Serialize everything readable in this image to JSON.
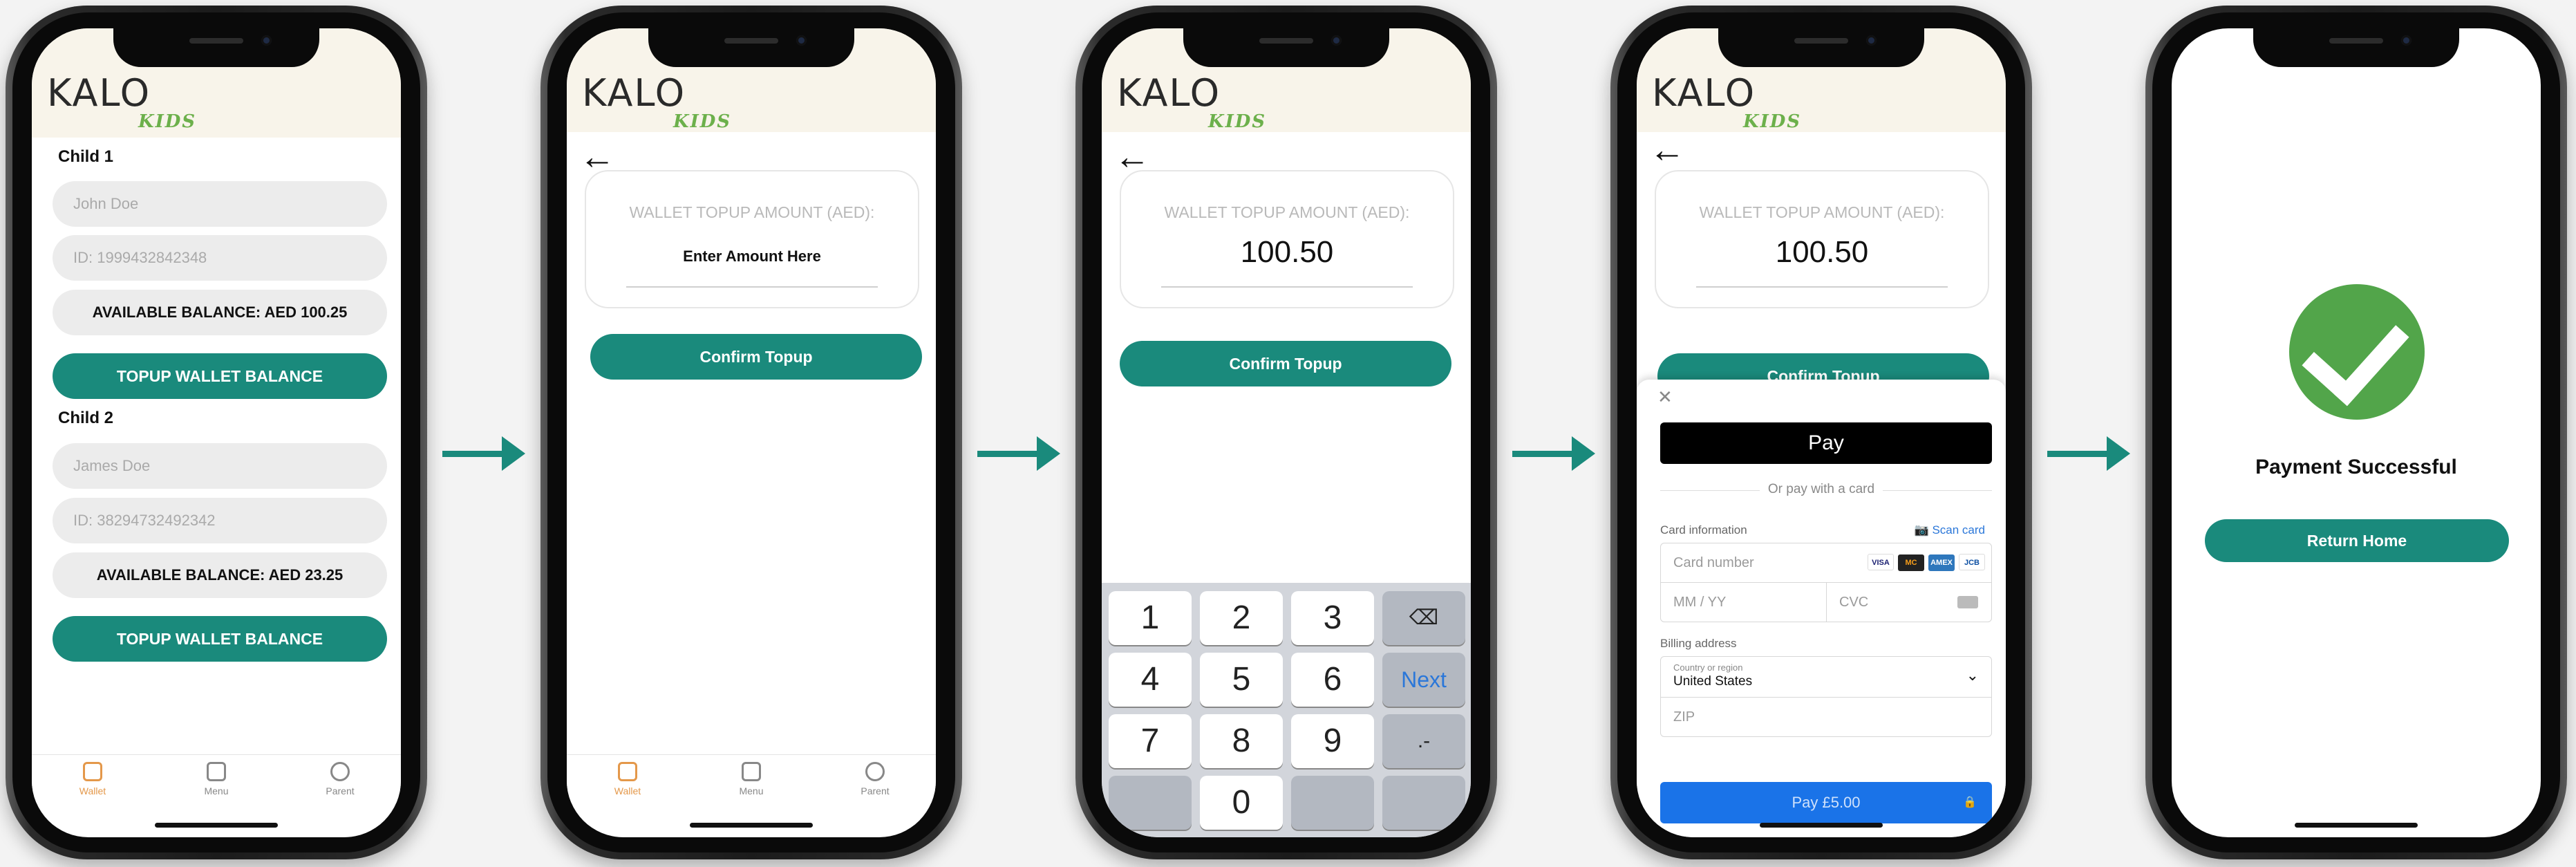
{
  "logo": {
    "word": "KALO",
    "sub": "KIDS"
  },
  "screen1": {
    "child1": {
      "title": "Child 1",
      "name_placeholder": "John Doe",
      "id_placeholder": "ID: 1999432842348",
      "balance": "AVAILABLE BALANCE: AED 100.25",
      "button": "TOPUP WALLET BALANCE"
    },
    "child2": {
      "title": "Child 2",
      "name_placeholder": "James Doe",
      "id_placeholder": "ID: 38294732492342",
      "balance": "AVAILABLE BALANCE: AED 23.25",
      "button": "TOPUP WALLET BALANCE"
    }
  },
  "tabs": [
    {
      "label": "Wallet",
      "icon": "wallet-icon"
    },
    {
      "label": "Menu",
      "icon": "menu-icon"
    },
    {
      "label": "Parent",
      "icon": "user-icon"
    }
  ],
  "topup": {
    "title": "WALLET TOPUP AMOUNT (AED):",
    "placeholder": "Enter Amount Here",
    "amount": "100.50",
    "confirm": "Confirm Topup"
  },
  "keyboard": {
    "keys": [
      "1",
      "2",
      "3",
      "⌫",
      "4",
      "5",
      "6",
      "Next",
      "7",
      "8",
      "9",
      ".-",
      "0"
    ]
  },
  "payment_sheet": {
    "close": "✕",
    "apple_pay": " Pay",
    "or_text": "Or pay with a card",
    "card_info": "Card information",
    "scan": "Scan card",
    "card_number": "Card number",
    "expiry": "MM / YY",
    "cvc": "CVC",
    "billing": "Billing address",
    "country_label": "Country or region",
    "country": "United States",
    "zip": "ZIP",
    "pay": "Pay £5.00",
    "card_brands": [
      "VISA",
      "MC",
      "AMEX",
      "JCB"
    ]
  },
  "success": {
    "title": "Payment Successful",
    "button": "Return Home"
  },
  "colors": {
    "accent": "#1a8a7c",
    "header": "#f8f4ea",
    "active_tab": "#e4984a",
    "success": "#52a54a",
    "pay": "#1a73e8"
  }
}
